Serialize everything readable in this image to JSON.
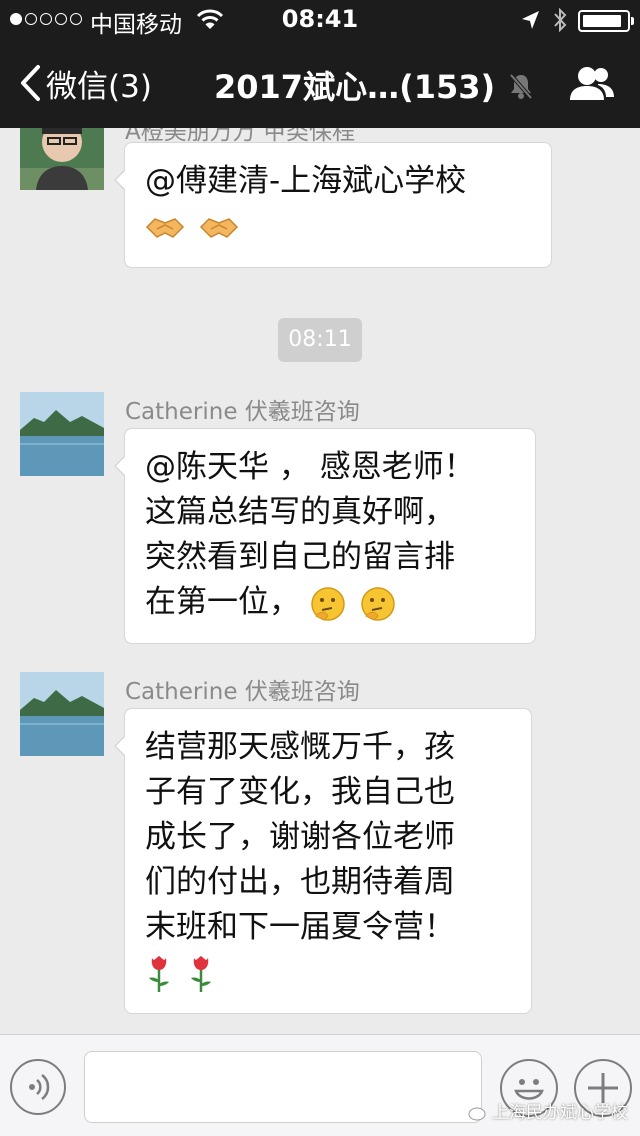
{
  "status_bar": {
    "carrier": "中国移动",
    "time": "08:41",
    "signal_dots_filled": 1,
    "signal_dots_total": 5,
    "battery_level": 0.9
  },
  "nav": {
    "back_label": "微信(3)",
    "title": "2017斌心…(153)"
  },
  "messages": [
    {
      "sender": "A橙美朋万万  甲类保程",
      "lines": [
        "@傅建清-上海斌心学校"
      ],
      "emoji": [
        "handshake",
        "handshake"
      ]
    },
    {
      "sender": "Catherine 伏羲班咨询",
      "lines": [
        "@陈天华 ， 感恩老师！",
        "这篇总结写的真好啊，",
        "突然看到自己的留言排",
        "在第一位，"
      ],
      "emoji": [
        "thinking",
        "thinking"
      ]
    },
    {
      "sender": "Catherine 伏羲班咨询",
      "lines": [
        "结营那天感慨万千，孩",
        "子有了变化，我自己也",
        "成长了，谢谢各位老师",
        "们的付出，也期待着周",
        "末班和下一届夏令营！"
      ],
      "emoji": [
        "rose",
        "rose"
      ]
    }
  ],
  "timestamp": "08:11",
  "input": {
    "placeholder": ""
  },
  "watermark": "上海民办斌心学校",
  "colors": {
    "nav_bg": "#1c1c1c",
    "chat_bg": "#ebebeb",
    "bubble_bg": "#ffffff",
    "pill_bg": "#cfcfcf"
  }
}
